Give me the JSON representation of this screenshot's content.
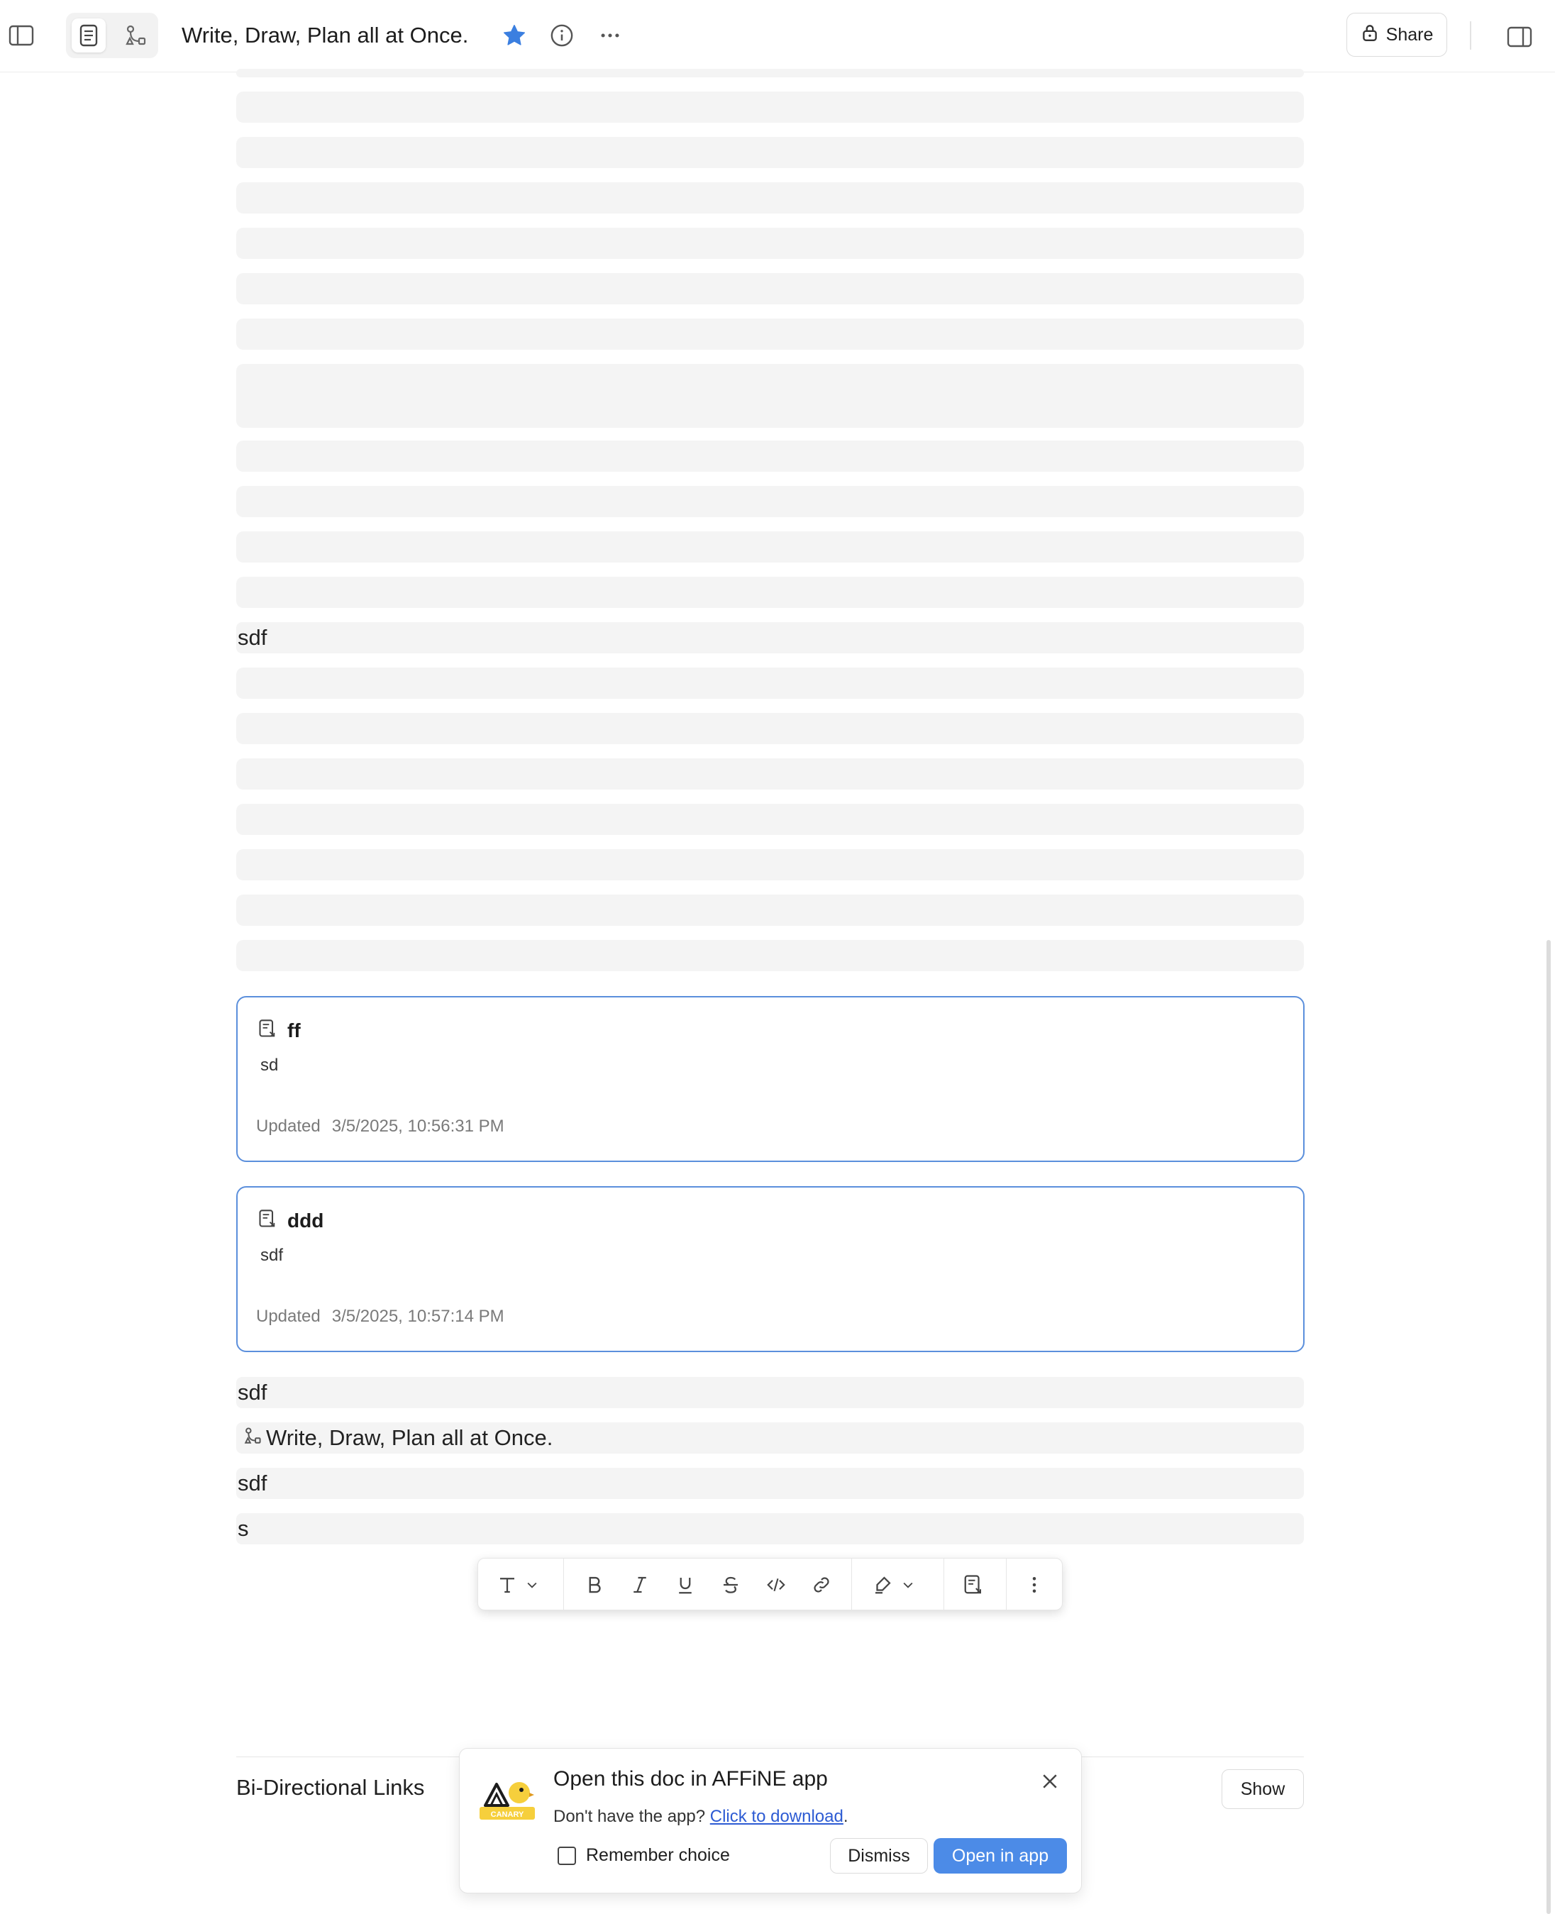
{
  "header": {
    "title": "Write, Draw, Plan all at Once.",
    "share_label": "Share",
    "favorite_color": "#3b7fe0",
    "icons": [
      "sidebar-toggle-icon",
      "page-mode-icon",
      "edgeless-mode-icon",
      "star-icon",
      "info-icon",
      "more-icon",
      "lock-icon",
      "right-panel-icon"
    ]
  },
  "document": {
    "sdf_line_1": "sdf",
    "linked_cards": [
      {
        "title": "ff",
        "body": "sd",
        "updated_label": "Updated",
        "updated_time": "3/5/2025, 10:56:31 PM"
      },
      {
        "title": "ddd",
        "body": "sdf",
        "updated_label": "Updated",
        "updated_time": "3/5/2025, 10:57:14 PM"
      }
    ],
    "sdf_line_2": "sdf",
    "doc_link_text": "Write, Draw, Plan all at Once.",
    "sdf_line_3": "sdf",
    "s_line": "s"
  },
  "toolbar": {
    "items": [
      "text-type",
      "bold",
      "italic",
      "underline",
      "strikethrough",
      "inline-code",
      "link",
      "highlight",
      "create-linked-doc",
      "more"
    ]
  },
  "backlinks": {
    "title": "Bi-Directional Links",
    "show_label": "Show"
  },
  "popup": {
    "title": "Open this doc in AFFiNE app",
    "subtitle_prefix": "Don't have the app?",
    "download_link": "Click to download",
    "subtitle_suffix": ".",
    "remember_label": "Remember choice",
    "dismiss_label": "Dismiss",
    "open_label": "Open in app",
    "logo_text": "CANARY"
  }
}
